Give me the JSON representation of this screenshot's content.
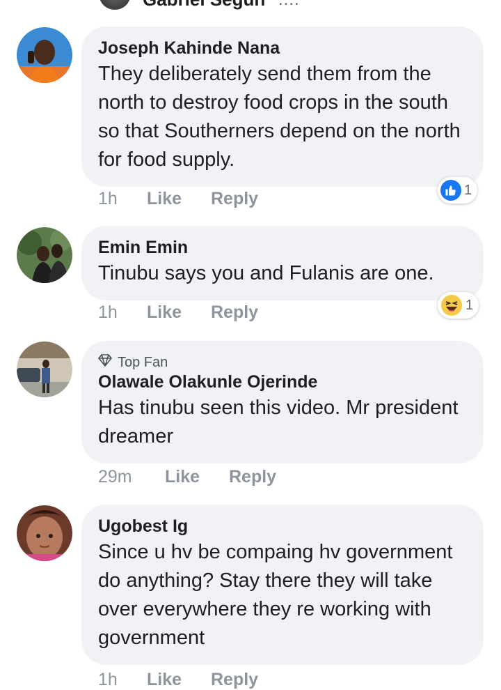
{
  "prev_comment": {
    "name_fragment": "Gabriel Segun",
    "text_fragment": "...."
  },
  "icons": {
    "like_reaction": "thumbs-up-icon",
    "haha_reaction": "laughing-face-icon",
    "top_fan": "diamond-icon"
  },
  "colors": {
    "bubble": "#f0f2f5",
    "like_blue": "#1877f2",
    "meta_gray": "#8d949e"
  },
  "comments": [
    {
      "author": "Joseph Kahinde Nana",
      "text": "They deliberately send them from the north to destroy food crops in the south so that Southerners depend on the north for food supply.",
      "time": "1h",
      "like_label": "Like",
      "reply_label": "Reply",
      "reaction": "like",
      "reaction_count": "1"
    },
    {
      "author": "Emin Emin",
      "text": "Tinubu says you and Fulanis are one.",
      "time": "1h",
      "like_label": "Like",
      "reply_label": "Reply",
      "reaction": "haha",
      "reaction_count": "1"
    },
    {
      "badge": "Top Fan",
      "author": "Olawale Olakunle Ojerinde",
      "text": "Has tinubu seen this video. Mr president dreamer",
      "time": "29m",
      "like_label": "Like",
      "reply_label": "Reply"
    },
    {
      "author": "Ugobest Ig",
      "text": "Since u hv be compaing hv government do anything? Stay there they will take over everywhere they re working with government",
      "time": "1h",
      "like_label": "Like",
      "reply_label": "Reply"
    }
  ]
}
